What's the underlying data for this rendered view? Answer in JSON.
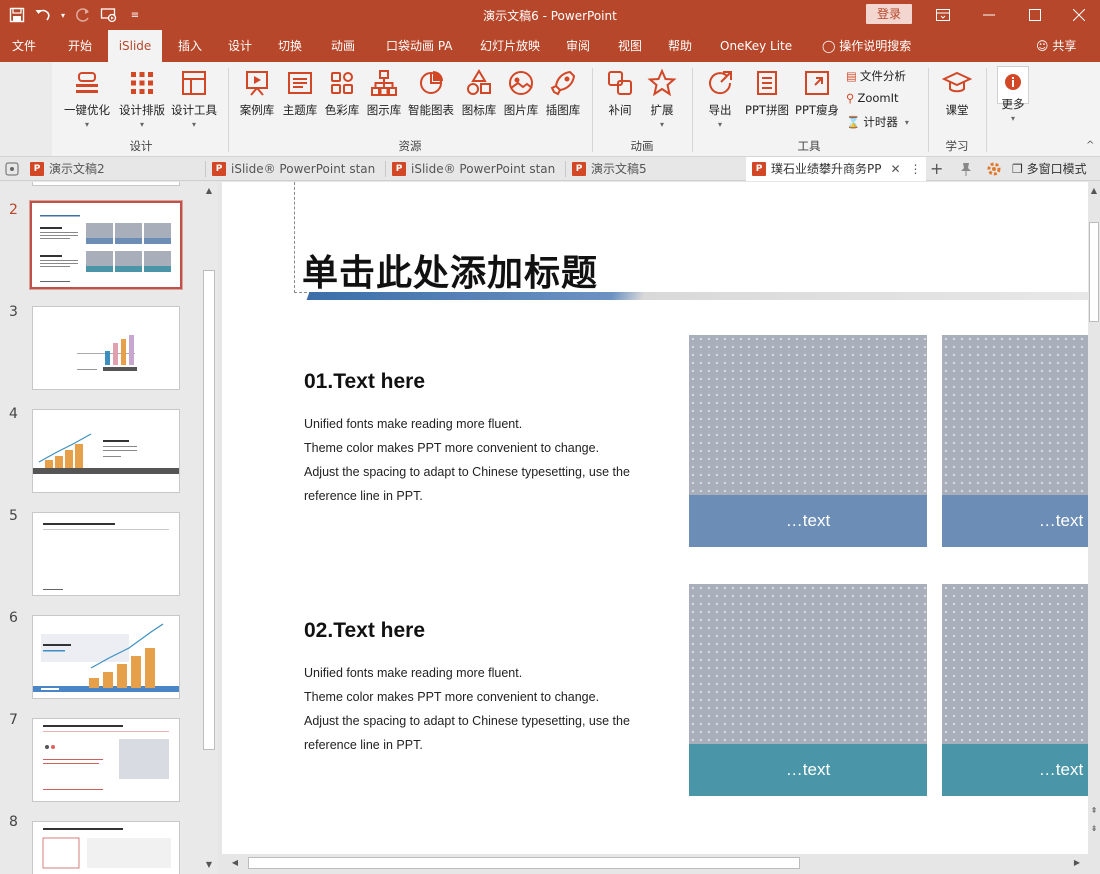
{
  "window": {
    "title": "演示文稿6  -  PowerPoint",
    "login_label": "登录",
    "accent": "#b7472a"
  },
  "tabs": [
    "文件",
    "开始",
    "iSlide",
    "插入",
    "设计",
    "切换",
    "动画",
    "口袋动画 PA",
    "幻灯片放映",
    "审阅",
    "视图",
    "帮助",
    "OneKey Lite",
    "操作说明搜索"
  ],
  "active_tab": "iSlide",
  "share_label": "共享",
  "ribbon": {
    "buttons": {
      "one_click": "一键优化",
      "layout": "设计排版",
      "tools": "设计工具",
      "cases": "案例库",
      "themes": "主题库",
      "colors": "色彩库",
      "diagrams": "图示库",
      "smart_charts": "智能图表",
      "icons": "图标库",
      "images": "图片库",
      "illustrations": "插图库",
      "tween": "补间",
      "extend": "扩展",
      "export": "导出",
      "ppt_collage": "PPT拼图",
      "ppt_slim": "PPT瘦身",
      "file_analysis": "文件分析",
      "zoomit": "ZoomIt",
      "timer": "计时器",
      "classroom": "课堂",
      "more": "更多"
    },
    "groups": {
      "design": "设计",
      "resources": "资源",
      "animation": "动画",
      "tools": "工具",
      "learn": "学习"
    }
  },
  "doc_tabs": [
    "演示文稿2",
    "iSlide® PowerPoint stan",
    "iSlide® PowerPoint stan",
    "演示文稿5",
    "璞石业绩攀升商务PP"
  ],
  "multi_window": "多窗口模式",
  "thumbnails": [
    "2",
    "3",
    "4",
    "5",
    "6",
    "7",
    "8"
  ],
  "selected_slide": "2",
  "slide": {
    "title": "单击此处添加标题",
    "sections": [
      {
        "heading": "01.Text here",
        "lines": [
          "Unified fonts make reading more fluent.",
          "Theme color makes PPT more convenient to change.",
          "Adjust the spacing to adapt to Chinese typesetting, use the",
          "reference line in PPT."
        ]
      },
      {
        "heading": "02.Text here",
        "lines": [
          "Unified fonts make reading more fluent.",
          "Theme color makes PPT more convenient to change.",
          "Adjust the spacing to adapt to Chinese typesetting, use the",
          "reference line in PPT."
        ]
      }
    ],
    "card_caption": "…text",
    "card_colors": {
      "blue": "#6c8db5",
      "teal": "#4a96a8"
    }
  }
}
